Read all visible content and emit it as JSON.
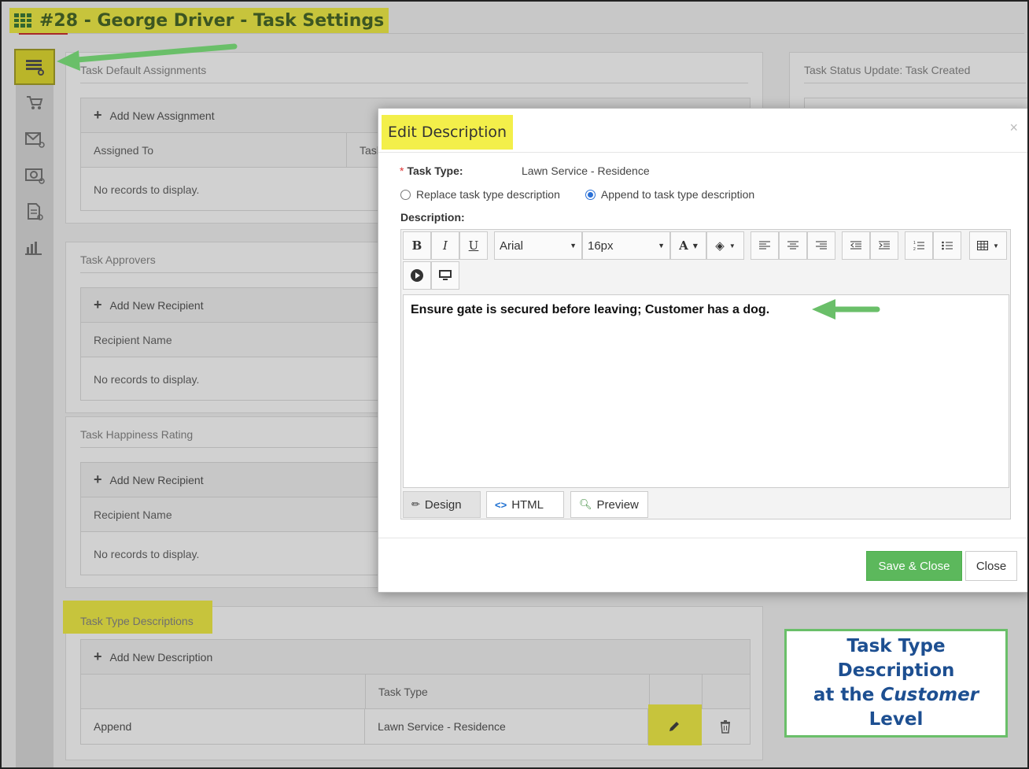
{
  "header": {
    "title": "#28 - George Driver - Task Settings"
  },
  "sidebar": {
    "items": [
      {
        "name": "task-settings",
        "active": true
      },
      {
        "name": "cart"
      },
      {
        "name": "email"
      },
      {
        "name": "billing"
      },
      {
        "name": "document"
      },
      {
        "name": "report"
      }
    ]
  },
  "panels": {
    "default_assignments": {
      "title": "Task Default Assignments",
      "add_label": "Add New Assignment",
      "columns": [
        "Assigned To",
        "Task"
      ],
      "empty": "No records to display."
    },
    "approvers": {
      "title": "Task Approvers",
      "add_label": "Add New Recipient",
      "columns": [
        "Recipient Name"
      ],
      "empty": "No records to display."
    },
    "happiness": {
      "title": "Task Happiness Rating",
      "add_label": "Add New Recipient",
      "columns": [
        "Recipient Name"
      ],
      "empty": "No records to display."
    },
    "type_descriptions": {
      "title": "Task Type Descriptions",
      "add_label": "Add New Description",
      "columns": [
        "",
        "Task Type"
      ],
      "row": {
        "mode": "Append",
        "task_type": "Lawn Service - Residence"
      }
    },
    "status_update": {
      "title": "Task Status Update: Task Created"
    }
  },
  "modal": {
    "title": "Edit Description",
    "close_glyph": "×",
    "task_type_label": "Task Type:",
    "task_type_value": "Lawn Service - Residence",
    "options": [
      {
        "label": "Replace task type description",
        "checked": false
      },
      {
        "label": "Append to task type description",
        "checked": true
      }
    ],
    "description_label": "Description:",
    "editor": {
      "font": "Arial",
      "size": "16px",
      "content": "Ensure gate is secured before leaving; Customer has a dog.",
      "modes": [
        "Design",
        "HTML",
        "Preview"
      ],
      "active_mode": "Design"
    },
    "buttons": {
      "save": "Save & Close",
      "close": "Close"
    }
  },
  "callout": {
    "line1": "Task Type Description",
    "line2_prefix": "at the",
    "line2_em": "Customer",
    "line2_suffix": "Level"
  },
  "colors": {
    "highlight": "#f3ef4a",
    "arrow": "#6abf69",
    "save_button": "#5cb85c",
    "callout_text": "#1d4f91"
  }
}
